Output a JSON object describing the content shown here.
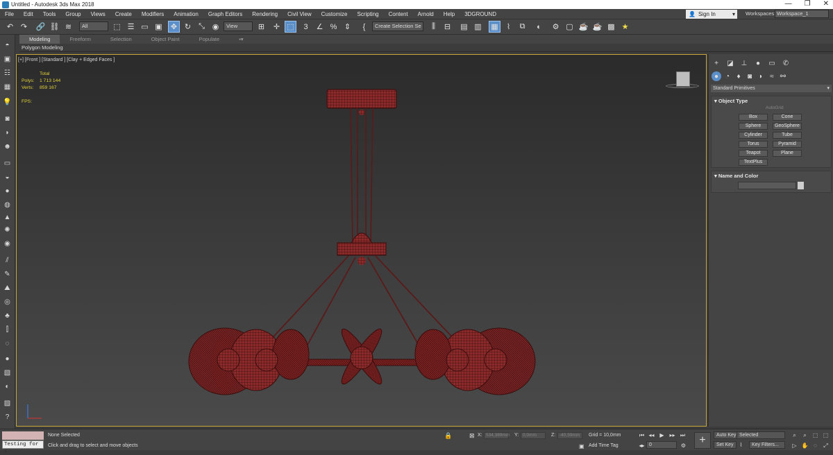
{
  "window": {
    "title": "Untitled - Autodesk 3ds Max 2018",
    "controls": [
      "—",
      "❐",
      "✕"
    ]
  },
  "menu": [
    "File",
    "Edit",
    "Tools",
    "Group",
    "Views",
    "Create",
    "Modifiers",
    "Animation",
    "Graph Editors",
    "Rendering",
    "Civil View",
    "Customize",
    "Scripting",
    "Content",
    "Arnold",
    "Help",
    "3DGROUND"
  ],
  "account": {
    "signin": "Sign In",
    "workspaces_label": "Workspaces:",
    "workspace": "Workspace_1"
  },
  "toolbar": {
    "filter_select": "All",
    "view_select": "View",
    "selection_set": "Create Selection Se"
  },
  "ribbon": {
    "tabs": [
      "Modeling",
      "Freeform",
      "Selection",
      "Object Paint",
      "Populate"
    ],
    "sub_label": "Polygon Modeling"
  },
  "viewport": {
    "label": "[+] [Front ] [Standard ] [Clay + Edged Faces ]",
    "stats": {
      "total": "Total",
      "polys_label": "Polys:",
      "polys": "1 713 144",
      "verts_label": "Verts:",
      "verts": "859 167",
      "fps_label": "FPS:"
    }
  },
  "command_panel": {
    "category": "Standard Primitives",
    "object_type_title": "Object Type",
    "autogrid": "AutoGrid",
    "buttons": [
      "Box",
      "Cone",
      "Sphere",
      "GeoSphere",
      "Cylinder",
      "Tube",
      "Torus",
      "Pyramid",
      "Teapot",
      "Plane",
      "TextPlus"
    ],
    "name_color_title": "Name and Color"
  },
  "status": {
    "script_input": "Testing for :",
    "selection": "None Selected",
    "prompt": "Click and drag to select and move objects",
    "x_label": "X:",
    "x": "534,389mm",
    "y_label": "Y:",
    "y": "0,0mm",
    "z_label": "Z:",
    "z": "-40,59mm",
    "grid": "Grid = 10,0mm",
    "add_time_tag": "Add Time Tag",
    "frame": "0",
    "auto_key": "Auto Key",
    "set_key": "Set Key",
    "key_mode": "Selected",
    "key_filters": "Key Filters..."
  }
}
